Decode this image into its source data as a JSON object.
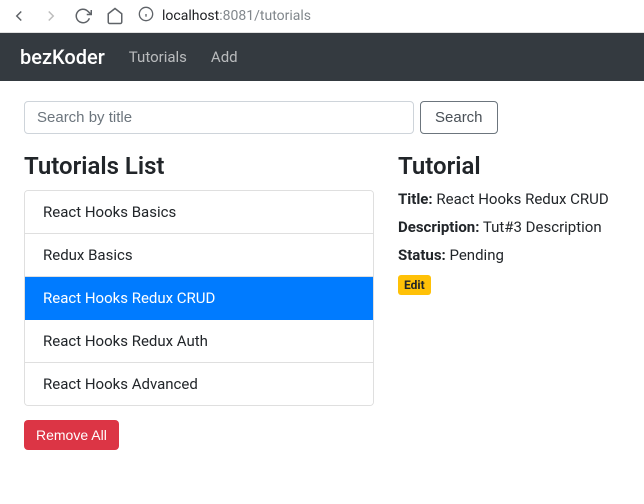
{
  "browser": {
    "url_host": "localhost",
    "url_port_path": ":8081/tutorials"
  },
  "nav": {
    "brand": "bezKoder",
    "links": [
      "Tutorials",
      "Add"
    ]
  },
  "search": {
    "placeholder": "Search by title",
    "button": "Search"
  },
  "list": {
    "heading": "Tutorials List",
    "items": [
      {
        "label": "React Hooks Basics"
      },
      {
        "label": "Redux Basics"
      },
      {
        "label": "React Hooks Redux CRUD"
      },
      {
        "label": "React Hooks Redux Auth"
      },
      {
        "label": "React Hooks Advanced"
      }
    ],
    "active_index": 2,
    "remove_all": "Remove All"
  },
  "detail": {
    "heading": "Tutorial",
    "title_label": "Title:",
    "title_value": "React Hooks Redux CRUD",
    "description_label": "Description:",
    "description_value": "Tut#3 Description",
    "status_label": "Status:",
    "status_value": "Pending",
    "edit": "Edit"
  }
}
